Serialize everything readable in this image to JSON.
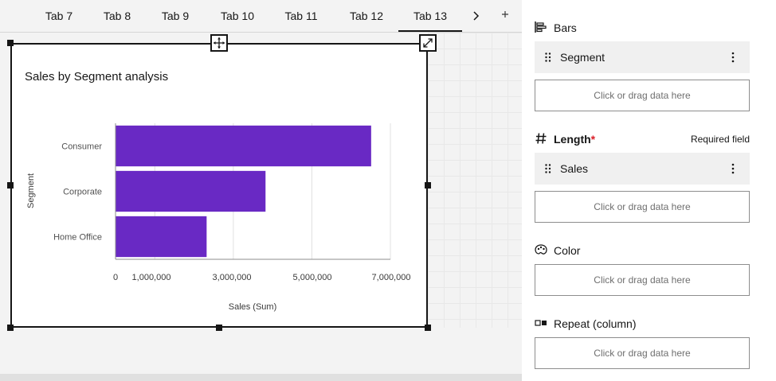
{
  "tabs": {
    "items": [
      "Tab 7",
      "Tab 8",
      "Tab 9",
      "Tab 10",
      "Tab 11",
      "Tab 12",
      "Tab 13"
    ],
    "active_index": 6
  },
  "widget": {
    "title": "Sales by Segment analysis"
  },
  "chart_data": {
    "type": "bar",
    "orientation": "horizontal",
    "title": "Sales by Segment analysis",
    "categories": [
      "Consumer",
      "Corporate",
      "Home Office"
    ],
    "values": [
      6510000,
      3820000,
      2320000
    ],
    "xlabel": "Sales (Sum)",
    "ylabel": "Segment",
    "xticks": [
      "0",
      "1,000,000",
      "3,000,000",
      "5,000,000",
      "7,000,000"
    ],
    "xlim": [
      0,
      7000000
    ],
    "grid": "vertical",
    "color": "#6929c4"
  },
  "panel": {
    "bars": {
      "label": "Bars",
      "field": "Segment",
      "dropzone": "Click or drag data here"
    },
    "length": {
      "label": "Length",
      "required_mark": "*",
      "required_note": "Required field",
      "field": "Sales",
      "dropzone": "Click or drag data here"
    },
    "color": {
      "label": "Color",
      "dropzone": "Click or drag data here"
    },
    "repeat": {
      "label": "Repeat (column)",
      "dropzone": "Click or drag data here"
    }
  }
}
